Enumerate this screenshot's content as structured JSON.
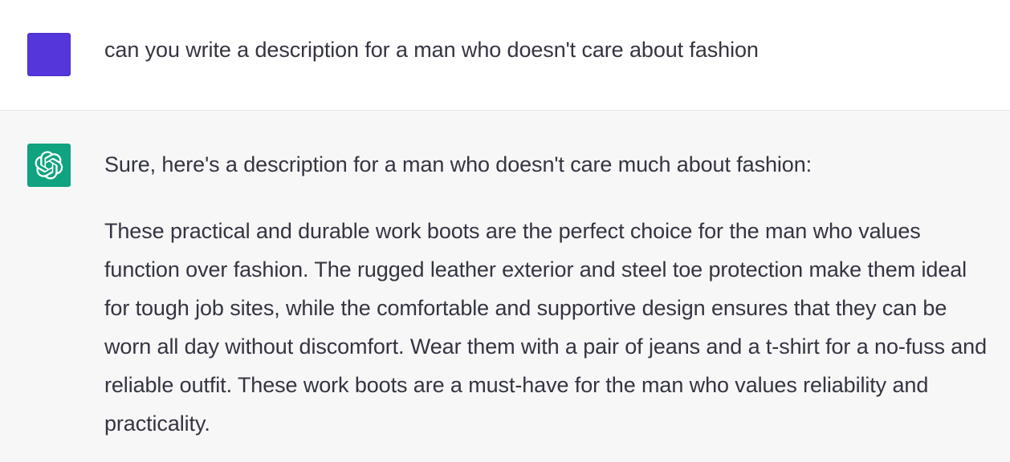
{
  "conversation": {
    "user_message": {
      "text": "can you write a description for a man who doesn't care about fashion"
    },
    "assistant_message": {
      "intro": "Sure, here's a description for a man who doesn't care much about fashion:",
      "body": "These practical and durable work boots are the perfect choice for the man who values function over fashion. The rugged leather exterior and steel toe protection make them ideal for tough job sites, while the comfortable and supportive design ensures that they can be worn all day without discomfort. Wear them with a pair of jeans and a t-shirt for a no-fuss and reliable outfit. These work boots are a must-have for the man who values reliability and practicality."
    }
  },
  "colors": {
    "user_avatar": "#5436da",
    "assistant_avatar": "#10a37f",
    "assistant_background": "#f7f7f8",
    "text": "#343541"
  },
  "icons": {
    "user_avatar": "user-avatar-icon",
    "assistant_avatar": "openai-logo-icon"
  }
}
